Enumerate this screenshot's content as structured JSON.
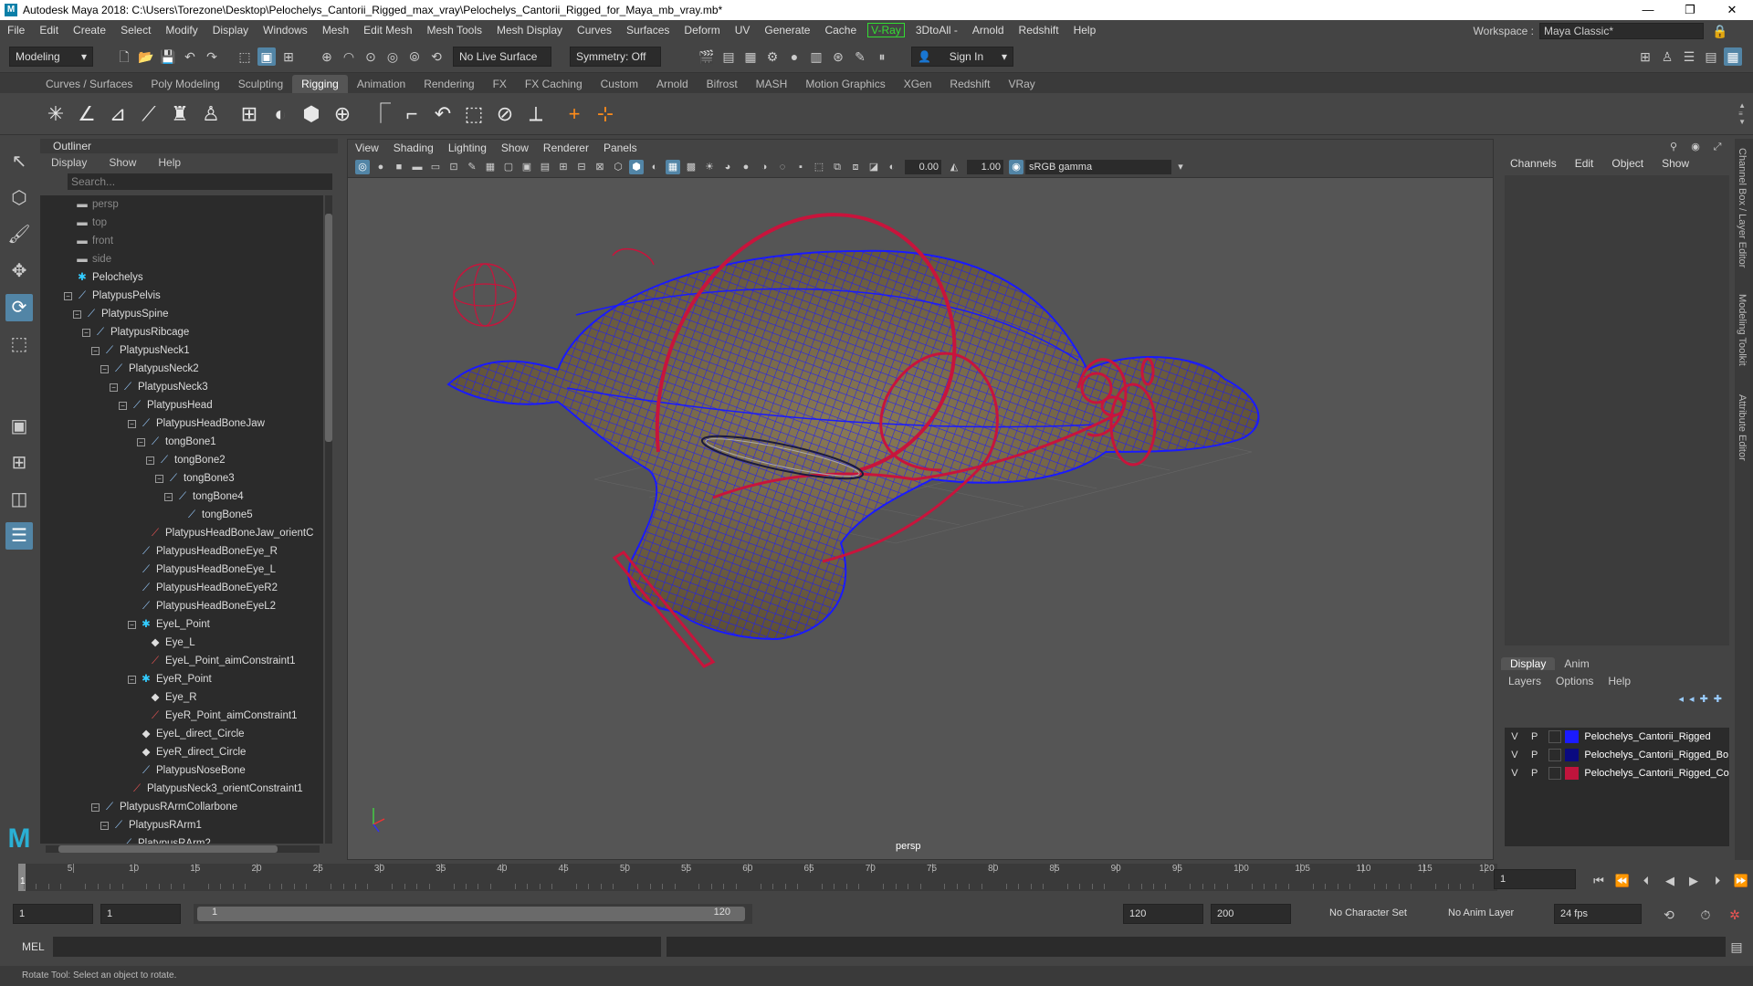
{
  "titlebar": {
    "title": "Autodesk Maya 2018: C:\\Users\\Torezone\\Desktop\\Pelochelys_Cantorii_Rigged_max_vray\\Pelochelys_Cantorii_Rigged_for_Maya_mb_vray.mb*",
    "minimize": "—",
    "restore": "❐",
    "close": "✕"
  },
  "menubar": {
    "items": [
      "File",
      "Edit",
      "Create",
      "Select",
      "Modify",
      "Display",
      "Windows",
      "Mesh",
      "Edit Mesh",
      "Mesh Tools",
      "Mesh Display",
      "Curves",
      "Surfaces",
      "Deform",
      "UV",
      "Generate",
      "Cache"
    ],
    "vray": "V-Ray",
    "items2": [
      "3DtoAll -",
      "Arnold",
      "Redshift",
      "Help"
    ],
    "workspace_label": "Workspace :",
    "workspace_value": "Maya Classic*"
  },
  "statusline": {
    "mode": "Modeling",
    "live_surface": "No Live Surface",
    "symmetry": "Symmetry: Off",
    "sign_in": "Sign In"
  },
  "shelftabs": [
    "Curves / Surfaces",
    "Poly Modeling",
    "Sculpting",
    "Rigging",
    "Animation",
    "Rendering",
    "FX",
    "FX Caching",
    "Custom",
    "Arnold",
    "Bifrost",
    "MASH",
    "Motion Graphics",
    "XGen",
    "Redshift",
    "VRay"
  ],
  "shelftabs_active": "Rigging",
  "outliner": {
    "title": "Outliner",
    "menu": [
      "Display",
      "Show",
      "Help"
    ],
    "search_placeholder": "Search...",
    "rows": [
      {
        "label": "persp",
        "indent": 0,
        "kind": "cam",
        "dim": true
      },
      {
        "label": "top",
        "indent": 0,
        "kind": "cam",
        "dim": true
      },
      {
        "label": "front",
        "indent": 0,
        "kind": "cam",
        "dim": true
      },
      {
        "label": "side",
        "indent": 0,
        "kind": "cam",
        "dim": true
      },
      {
        "label": "Pelochelys",
        "indent": 0,
        "kind": "cube"
      },
      {
        "label": "PlatypusPelvis",
        "indent": 0,
        "kind": "joint",
        "exp": true
      },
      {
        "label": "PlatypusSpine",
        "indent": 1,
        "kind": "joint",
        "exp": true
      },
      {
        "label": "PlatypusRibcage",
        "indent": 2,
        "kind": "joint",
        "exp": true
      },
      {
        "label": "PlatypusNeck1",
        "indent": 3,
        "kind": "joint",
        "exp": true
      },
      {
        "label": "PlatypusNeck2",
        "indent": 4,
        "kind": "joint",
        "exp": true
      },
      {
        "label": "PlatypusNeck3",
        "indent": 5,
        "kind": "joint",
        "exp": true
      },
      {
        "label": "PlatypusHead",
        "indent": 6,
        "kind": "joint",
        "exp": true
      },
      {
        "label": "PlatypusHeadBoneJaw",
        "indent": 7,
        "kind": "joint",
        "exp": true
      },
      {
        "label": "tongBone1",
        "indent": 8,
        "kind": "joint",
        "exp": true
      },
      {
        "label": "tongBone2",
        "indent": 9,
        "kind": "joint",
        "exp": true
      },
      {
        "label": "tongBone3",
        "indent": 10,
        "kind": "joint",
        "exp": true
      },
      {
        "label": "tongBone4",
        "indent": 11,
        "kind": "joint",
        "exp": true
      },
      {
        "label": "tongBone5",
        "indent": 12,
        "kind": "joint"
      },
      {
        "label": "PlatypusHeadBoneJaw_orientC",
        "indent": 8,
        "kind": "constr"
      },
      {
        "label": "PlatypusHeadBoneEye_R",
        "indent": 7,
        "kind": "joint"
      },
      {
        "label": "PlatypusHeadBoneEye_L",
        "indent": 7,
        "kind": "joint"
      },
      {
        "label": "PlatypusHeadBoneEyeR2",
        "indent": 7,
        "kind": "joint"
      },
      {
        "label": "PlatypusHeadBoneEyeL2",
        "indent": 7,
        "kind": "joint"
      },
      {
        "label": "EyeL_Point",
        "indent": 7,
        "kind": "cube",
        "exp": true
      },
      {
        "label": "Eye_L",
        "indent": 8,
        "kind": "crv"
      },
      {
        "label": "EyeL_Point_aimConstraint1",
        "indent": 8,
        "kind": "constr"
      },
      {
        "label": "EyeR_Point",
        "indent": 7,
        "kind": "cube",
        "exp": true
      },
      {
        "label": "Eye_R",
        "indent": 8,
        "kind": "crv"
      },
      {
        "label": "EyeR_Point_aimConstraint1",
        "indent": 8,
        "kind": "constr"
      },
      {
        "label": "EyeL_direct_Circle",
        "indent": 7,
        "kind": "crv"
      },
      {
        "label": "EyeR_direct_Circle",
        "indent": 7,
        "kind": "crv"
      },
      {
        "label": "PlatypusNoseBone",
        "indent": 7,
        "kind": "joint"
      },
      {
        "label": "PlatypusNeck3_orientConstraint1",
        "indent": 6,
        "kind": "constr"
      },
      {
        "label": "PlatypusRArmCollarbone",
        "indent": 3,
        "kind": "joint",
        "exp": true
      },
      {
        "label": "PlatypusRArm1",
        "indent": 4,
        "kind": "joint",
        "exp": true
      },
      {
        "label": "PlatypusRArm2",
        "indent": 5,
        "kind": "joint"
      }
    ]
  },
  "viewport": {
    "menu": [
      "View",
      "Shading",
      "Lighting",
      "Show",
      "Renderer",
      "Panels"
    ],
    "exposure": "0.00",
    "gamma": "1.00",
    "colorspace": "sRGB gamma",
    "camera": "persp"
  },
  "channelbox": {
    "menu": [
      "Channels",
      "Edit",
      "Object",
      "Show"
    ],
    "layer_tabs": [
      "Display",
      "Anim"
    ],
    "layer_tab_active": "Display",
    "layer_menu": [
      "Layers",
      "Options",
      "Help"
    ],
    "layers": [
      {
        "v": "V",
        "p": "P",
        "name": "Pelochelys_Cantorii_Rigged",
        "color": "#1b1bff"
      },
      {
        "v": "V",
        "p": "P",
        "name": "Pelochelys_Cantorii_Rigged_Bo",
        "color": "#0a0a80"
      },
      {
        "v": "V",
        "p": "P",
        "name": "Pelochelys_Cantorii_Rigged_Co",
        "color": "#c0143c"
      }
    ]
  },
  "sidetabs": [
    "Channel Box / Layer Editor",
    "Modeling Toolkit",
    "Attribute Editor"
  ],
  "timeline": {
    "ticks": [
      5,
      10,
      15,
      20,
      25,
      30,
      35,
      40,
      45,
      50,
      55,
      60,
      65,
      70,
      75,
      80,
      85,
      90,
      95,
      100,
      105,
      110,
      115,
      120
    ],
    "start": 1,
    "end": 120,
    "current": "1",
    "current_marker": "1"
  },
  "range": {
    "start_field": "1",
    "start2_field": "1",
    "inner_start": "1",
    "inner_end": "120",
    "end_field": "120",
    "end2_field": "200",
    "char_set": "No Character Set",
    "anim_layer": "No Anim Layer",
    "fps": "24 fps"
  },
  "cmdline": {
    "label": "MEL"
  },
  "helpline": {
    "text": "Rotate Tool: Select an object to rotate."
  },
  "colors": {
    "wire": "#1a1aff",
    "ctrl": "#c8143c",
    "shell": "#7a6a4a",
    "accent": "#5285a6"
  }
}
